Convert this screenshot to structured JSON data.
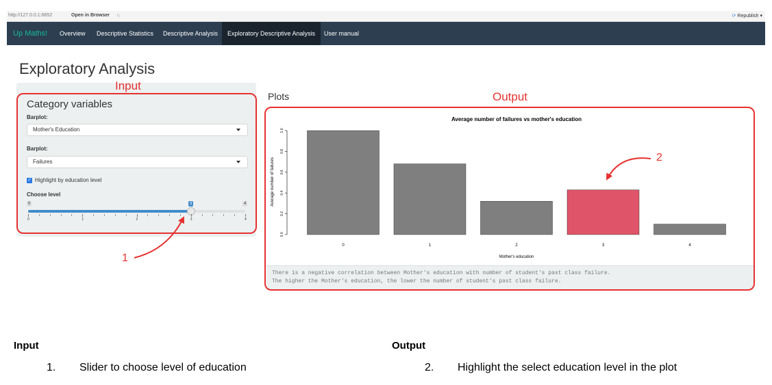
{
  "browser": {
    "url": "http://127.0.0.1:6652",
    "open_in_browser": "Open in Browser",
    "republish": "Republish"
  },
  "navbar": {
    "brand": "Up Maths!",
    "items": [
      "Overview",
      "Descriptive Statistics",
      "Descriptive Analysis",
      "Exploratory Descriptive Analysis",
      "User manual"
    ],
    "active_index": 3
  },
  "page": {
    "title": "Exploratory Analysis"
  },
  "sidebar": {
    "heading": "Category variables",
    "barplot1_label": "Barplot:",
    "barplot1_value": "Mother's Education",
    "barplot2_label": "Barplot:",
    "barplot2_value": "Failures",
    "checkbox_label": "Highlight by education level",
    "checkbox_checked": true,
    "slider_label": "Choose level",
    "slider_min": "0",
    "slider_max": "4",
    "slider_value": "3",
    "slider_fraction": 0.75,
    "slider_ticks": [
      "0",
      "1",
      "2",
      "3",
      "4"
    ]
  },
  "plots": {
    "title": "Plots",
    "caption_line1": "There is a negative correlation between Mother's education with number of student's past class failure.",
    "caption_line2": "The higher the Mother's education, the lower the number of student's past class failure."
  },
  "chart_data": {
    "type": "bar",
    "title": "Average number of failures vs mother's education",
    "xlabel": "Mother's education",
    "ylabel": "Average number of failures",
    "categories": [
      "0",
      "1",
      "2",
      "3",
      "4"
    ],
    "values": [
      1.0,
      0.68,
      0.32,
      0.43,
      0.1
    ],
    "ylim": [
      0,
      1.0
    ],
    "yticks": [
      "0.0",
      "0.2",
      "0.4",
      "0.6",
      "0.8",
      "1.0"
    ],
    "highlight_index": 3,
    "colors": {
      "default": "#7f7f7f",
      "highlight": "#e05469"
    }
  },
  "annotations": {
    "input": "Input",
    "output": "Output",
    "marker1": "1",
    "marker2": "2",
    "color": "#e5312f"
  },
  "legend_text": {
    "input_heading": "Input",
    "input_item_num": "1.",
    "input_item": "Slider to choose level of education",
    "output_heading": "Output",
    "output_item_num": "2.",
    "output_item": "Highlight the select education level in the plot"
  }
}
